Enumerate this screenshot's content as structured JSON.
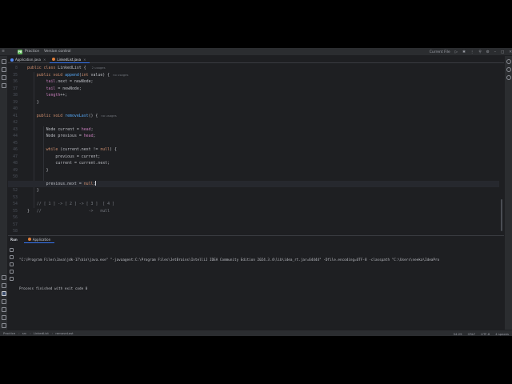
{
  "titlebar": {
    "project_badge": "PR",
    "project_name": "Practice",
    "vcs_label": "Version control",
    "run_config": "Current File"
  },
  "tabs": [
    {
      "label": "Application.java",
      "icon": "java-class-icon"
    },
    {
      "label": "LinkedList.java",
      "icon": "java-class-icon"
    }
  ],
  "editor": {
    "line_numbers": [
      "8",
      "35",
      "36",
      "37",
      "38",
      "39",
      "40",
      "41",
      "42",
      "43",
      "44",
      "45",
      "46",
      "47",
      "48",
      "49",
      "50",
      "51",
      "52",
      "53",
      "54",
      "55",
      "56",
      "57",
      "58"
    ],
    "lines": [
      {
        "indent": 0,
        "parts": [
          [
            "kw",
            "public class "
          ],
          [
            "",
            "LinkedList { "
          ]
        ],
        "hint": "2 usages"
      },
      {
        "indent": 1,
        "parts": [
          [
            "kw",
            "public void "
          ],
          [
            "fn",
            "append"
          ],
          [
            "",
            "("
          ],
          [
            "kw",
            "int "
          ],
          [
            "",
            "value) {"
          ]
        ],
        "hint": "no usages"
      },
      {
        "indent": 2,
        "parts": [
          [
            "fld",
            "tail"
          ],
          [
            "",
            ".next = newNode;"
          ]
        ]
      },
      {
        "indent": 2,
        "parts": [
          [
            "fld",
            "tail"
          ],
          [
            "",
            " = newNode;"
          ]
        ]
      },
      {
        "indent": 2,
        "parts": [
          [
            "fld",
            "length"
          ],
          [
            "",
            "++;"
          ]
        ]
      },
      {
        "indent": 1,
        "parts": [
          [
            "",
            "}"
          ]
        ]
      },
      {
        "indent": 0,
        "parts": []
      },
      {
        "indent": 1,
        "parts": [
          [
            "kw",
            "public void "
          ],
          [
            "fn",
            "removeLast"
          ],
          [
            "",
            "() {"
          ]
        ],
        "hint": "no usages"
      },
      {
        "indent": 0,
        "parts": []
      },
      {
        "indent": 2,
        "parts": [
          [
            "",
            "Node "
          ],
          [
            "",
            "current"
          ],
          [
            "",
            " = "
          ],
          [
            "fld",
            "head"
          ],
          [
            "",
            ";"
          ]
        ]
      },
      {
        "indent": 2,
        "parts": [
          [
            "",
            "Node "
          ],
          [
            "",
            "previous"
          ],
          [
            "",
            " = "
          ],
          [
            "fld",
            "head"
          ],
          [
            "",
            ";"
          ]
        ]
      },
      {
        "indent": 0,
        "parts": []
      },
      {
        "indent": 2,
        "parts": [
          [
            "kw",
            "while "
          ],
          [
            "",
            "("
          ],
          [
            "",
            "current"
          ],
          [
            "",
            ".next != "
          ],
          [
            "kw",
            "null"
          ],
          [
            "",
            ") {"
          ]
        ]
      },
      {
        "indent": 3,
        "parts": [
          [
            "",
            "previous"
          ],
          [
            "",
            " = "
          ],
          [
            "",
            "current"
          ],
          [
            "",
            ";"
          ]
        ]
      },
      {
        "indent": 3,
        "parts": [
          [
            "",
            "current"
          ],
          [
            "",
            " = "
          ],
          [
            "",
            "current"
          ],
          [
            "",
            ".next;"
          ]
        ]
      },
      {
        "indent": 2,
        "parts": [
          [
            "",
            "}"
          ]
        ]
      },
      {
        "indent": 0,
        "parts": []
      },
      {
        "indent": 2,
        "parts": [
          [
            "",
            "previous"
          ],
          [
            "",
            ".next = "
          ],
          [
            "kw",
            "null"
          ],
          [
            "",
            ";"
          ]
        ],
        "current": true
      },
      {
        "indent": 1,
        "parts": [
          [
            "",
            "}"
          ]
        ]
      },
      {
        "indent": 0,
        "parts": []
      },
      {
        "indent": 1,
        "parts": [
          [
            "cmt",
            "// [ 1 ] -> [ 2 ] -> [ 3 ]  [ 4 ]"
          ]
        ]
      },
      {
        "indent": 0,
        "parts": [
          [
            "",
            "}"
          ],
          [
            "cmt",
            "   //                    ->   null"
          ]
        ]
      }
    ]
  },
  "run_panel": {
    "label": "Run",
    "tab": "Application",
    "console": [
      "\"C:\\Program Files\\Java\\jdk-17\\bin\\java.exe\" \"-javaagent:C:\\Program Files\\JetBrains\\IntelliJ IDEA Community Edition 2024.3.4\\lib\\idea_rt.jar=64444\" -Dfile.encoding=UTF-8 -classpath \"C:\\Users\\neeka\\IdeaPro",
      "",
      "Process finished with exit code 0"
    ]
  },
  "statusbar": {
    "breadcrumbs": [
      "Practice",
      "src",
      "LinkedList",
      "removeLast"
    ],
    "position": "54:29",
    "line_sep": "CRLF",
    "encoding": "UTF-8",
    "indent": "4 spaces"
  },
  "colors": {
    "background": "#1e1f22",
    "panel": "#2b2d30",
    "accent": "#3574f0",
    "keyword": "#cf8e6d",
    "function": "#56a8f5",
    "field": "#c77dbb"
  }
}
